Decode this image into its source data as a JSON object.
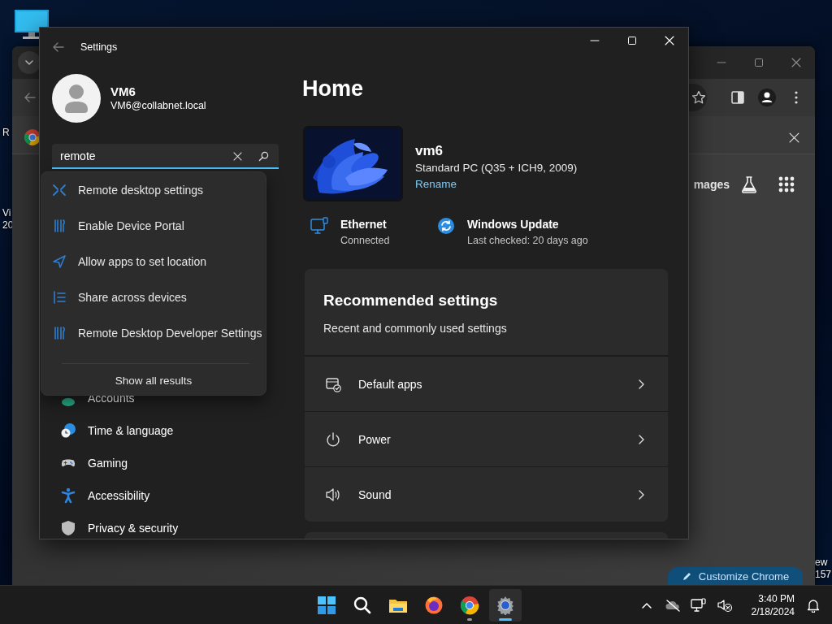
{
  "desktop": {
    "left_labels": [
      "R",
      "Vi",
      "20"
    ],
    "right_labels": [
      "ew",
      "157"
    ]
  },
  "chrome_window": {
    "header_link": "mages",
    "customize_button": "Customize Chrome"
  },
  "settings_window": {
    "title": "Settings",
    "profile": {
      "name": "VM6",
      "email": "VM6@collabnet.local"
    },
    "search": {
      "value": "remote"
    },
    "search_results": [
      {
        "kind": "remote",
        "label": "Remote desktop settings"
      },
      {
        "kind": "tools",
        "label": "Enable Device Portal"
      },
      {
        "kind": "location",
        "label": "Allow apps to set location"
      },
      {
        "kind": "share",
        "label": "Share across devices"
      },
      {
        "kind": "tools",
        "label": "Remote Desktop Developer Settings"
      }
    ],
    "show_all": "Show all results",
    "nav": [
      {
        "kind": "accounts",
        "label": "Accounts"
      },
      {
        "kind": "time",
        "label": "Time & language"
      },
      {
        "kind": "gaming",
        "label": "Gaming"
      },
      {
        "kind": "accessibility",
        "label": "Accessibility"
      },
      {
        "kind": "privacy",
        "label": "Privacy & security"
      }
    ],
    "page_title": "Home",
    "device": {
      "name": "vm6",
      "model": "Standard PC (Q35 + ICH9, 2009)",
      "rename": "Rename"
    },
    "status": [
      {
        "kind": "ethernet",
        "title": "Ethernet",
        "detail": "Connected"
      },
      {
        "kind": "update",
        "title": "Windows Update",
        "detail": "Last checked: 20 days ago"
      }
    ],
    "recommended": {
      "title": "Recommended settings",
      "subtitle": "Recent and commonly used settings",
      "rows": [
        {
          "kind": "apps",
          "label": "Default apps"
        },
        {
          "kind": "power",
          "label": "Power"
        },
        {
          "kind": "sound",
          "label": "Sound"
        }
      ]
    }
  },
  "taskbar": {
    "apps": [
      {
        "kind": "start",
        "running": false,
        "selected": false
      },
      {
        "kind": "search",
        "running": false,
        "selected": false
      },
      {
        "kind": "explorer",
        "running": false,
        "selected": false
      },
      {
        "kind": "firefox",
        "running": false,
        "selected": false
      },
      {
        "kind": "chrome",
        "running": true,
        "selected": false
      },
      {
        "kind": "settings",
        "running": true,
        "selected": true
      }
    ],
    "clock": {
      "time": "3:40 PM",
      "date": "2/18/2024"
    }
  }
}
